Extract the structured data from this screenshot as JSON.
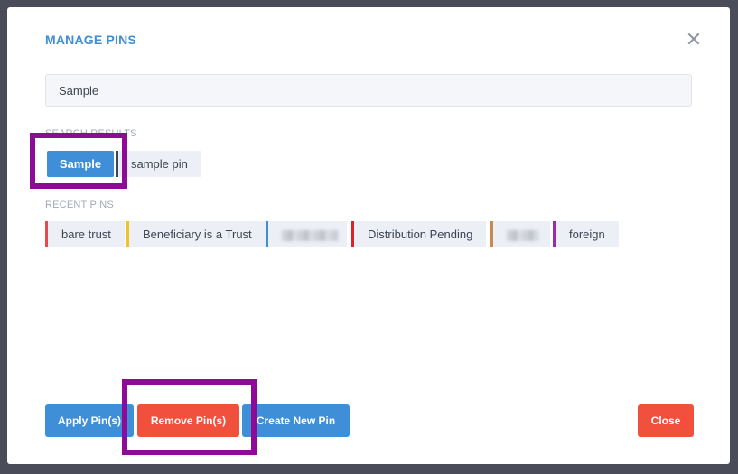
{
  "modal": {
    "title": "MANAGE PINS",
    "close_icon": "close-icon"
  },
  "search": {
    "value": "Sample",
    "placeholder": ""
  },
  "search_results": {
    "label": "SEARCH RESULTS",
    "items": [
      {
        "label": "Sample",
        "selected": true
      },
      {
        "label": "sample pin",
        "selected": false,
        "color": "#3d4452"
      }
    ]
  },
  "recent_pins": {
    "label": "RECENT PINS",
    "items": [
      {
        "label": "bare trust",
        "color": "#e54b4b"
      },
      {
        "label": "Beneficiary is a Trust",
        "color": "#f0c228"
      },
      {
        "label": "",
        "color": "#3e8ed8",
        "redacted": true
      },
      {
        "label": "Distribution Pending",
        "color": "#d9252a"
      },
      {
        "label": "",
        "color": "#c98a50",
        "redacted": true
      },
      {
        "label": "foreign",
        "color": "#9b2ba6"
      }
    ]
  },
  "footer": {
    "apply_label": "Apply Pin(s)",
    "remove_label": "Remove Pin(s)",
    "create_label": "Create New Pin",
    "close_label": "Close"
  },
  "colors": {
    "accent": "#3e8ed8",
    "danger": "#f0503c",
    "highlight": "#8e0b97"
  }
}
